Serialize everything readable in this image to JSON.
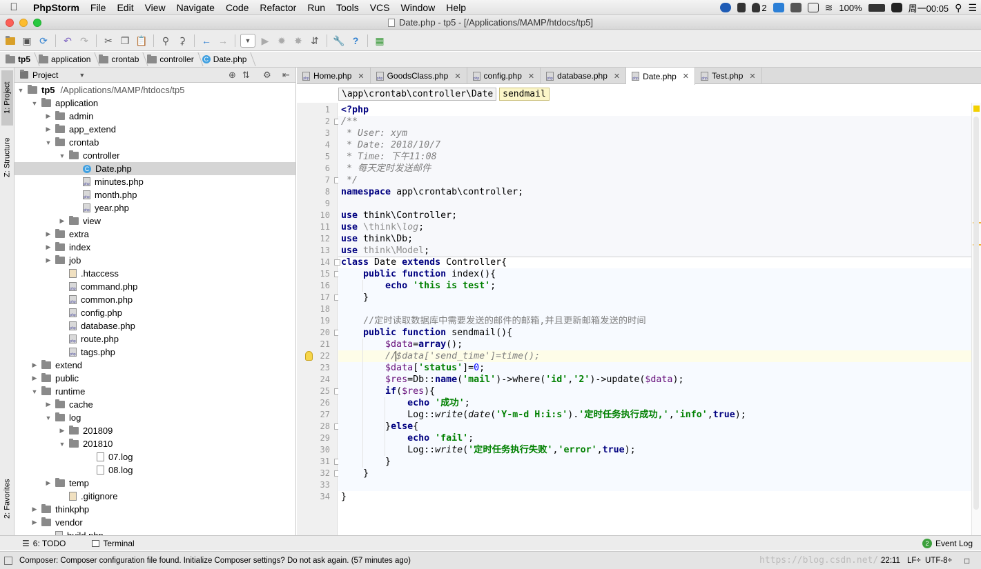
{
  "menubar": {
    "items": [
      "PhpStorm",
      "File",
      "Edit",
      "View",
      "Navigate",
      "Code",
      "Refactor",
      "Run",
      "Tools",
      "VCS",
      "Window",
      "Help"
    ],
    "right": {
      "badge": "2",
      "battery": "100%",
      "clock": "周一00:05"
    }
  },
  "window": {
    "title": "Date.php - tp5 - [/Applications/MAMP/htdocs/tp5]"
  },
  "breadcrumb": [
    "tp5",
    "application",
    "crontab",
    "controller",
    "Date.php"
  ],
  "leftstrip": {
    "project_tab": "1: Project",
    "structure_tab": "Z: Structure",
    "favorites_tab": "2: Favorites"
  },
  "project": {
    "header": "Project",
    "root_name": "tp5",
    "root_path": "/Applications/MAMP/htdocs/tp5",
    "rows": [
      {
        "label": "application",
        "depth": 1,
        "type": "folder",
        "open": true
      },
      {
        "label": "admin",
        "depth": 2,
        "type": "folder",
        "open": false
      },
      {
        "label": "app_extend",
        "depth": 2,
        "type": "folder",
        "open": false
      },
      {
        "label": "crontab",
        "depth": 2,
        "type": "folder",
        "open": true
      },
      {
        "label": "controller",
        "depth": 3,
        "type": "folder",
        "open": true
      },
      {
        "label": "Date.php",
        "depth": 4,
        "type": "class",
        "selected": true
      },
      {
        "label": "minutes.php",
        "depth": 4,
        "type": "php"
      },
      {
        "label": "month.php",
        "depth": 4,
        "type": "php"
      },
      {
        "label": "year.php",
        "depth": 4,
        "type": "php"
      },
      {
        "label": "view",
        "depth": 3,
        "type": "folder",
        "open": false
      },
      {
        "label": "extra",
        "depth": 2,
        "type": "folder",
        "open": false
      },
      {
        "label": "index",
        "depth": 2,
        "type": "folder",
        "open": false
      },
      {
        "label": "job",
        "depth": 2,
        "type": "folder",
        "open": false
      },
      {
        "label": ".htaccess",
        "depth": 3,
        "type": "file"
      },
      {
        "label": "command.php",
        "depth": 3,
        "type": "php"
      },
      {
        "label": "common.php",
        "depth": 3,
        "type": "php"
      },
      {
        "label": "config.php",
        "depth": 3,
        "type": "php"
      },
      {
        "label": "database.php",
        "depth": 3,
        "type": "php"
      },
      {
        "label": "route.php",
        "depth": 3,
        "type": "php"
      },
      {
        "label": "tags.php",
        "depth": 3,
        "type": "php"
      },
      {
        "label": "extend",
        "depth": 1,
        "type": "folder",
        "open": false
      },
      {
        "label": "public",
        "depth": 1,
        "type": "folder",
        "open": false
      },
      {
        "label": "runtime",
        "depth": 1,
        "type": "folder",
        "open": true
      },
      {
        "label": "cache",
        "depth": 2,
        "type": "folder",
        "open": false
      },
      {
        "label": "log",
        "depth": 2,
        "type": "folder",
        "open": true
      },
      {
        "label": "201809",
        "depth": 3,
        "type": "folder",
        "open": false
      },
      {
        "label": "201810",
        "depth": 3,
        "type": "folder",
        "open": true
      },
      {
        "label": "07.log",
        "depth": 5,
        "type": "log"
      },
      {
        "label": "08.log",
        "depth": 5,
        "type": "log"
      },
      {
        "label": "temp",
        "depth": 2,
        "type": "folder",
        "open": false
      },
      {
        "label": ".gitignore",
        "depth": 3,
        "type": "file"
      },
      {
        "label": "thinkphp",
        "depth": 1,
        "type": "folder",
        "open": false
      },
      {
        "label": "vendor",
        "depth": 1,
        "type": "folder",
        "open": false
      },
      {
        "label": "build.php",
        "depth": 2,
        "type": "php"
      }
    ]
  },
  "editor": {
    "tabs": [
      {
        "label": "Home.php",
        "active": false
      },
      {
        "label": "GoodsClass.php",
        "active": false
      },
      {
        "label": "config.php",
        "active": false
      },
      {
        "label": "database.php",
        "active": false
      },
      {
        "label": "Date.php",
        "active": true
      },
      {
        "label": "Test.php",
        "active": false
      }
    ],
    "nav_crumbs": [
      "\\app\\crontab\\controller\\Date",
      "sendmail"
    ],
    "current_line": 22,
    "lines": [
      [
        [
          "kw",
          "<?php"
        ]
      ],
      [
        [
          "cm",
          "/**"
        ]
      ],
      [
        [
          "cm",
          " * User: xym"
        ]
      ],
      [
        [
          "cm",
          " * Date: 2018/10/7"
        ]
      ],
      [
        [
          "cm",
          " * Time: 下午11:08"
        ]
      ],
      [
        [
          "cm",
          " * 每天定时发送邮件"
        ]
      ],
      [
        [
          "cm",
          " */"
        ]
      ],
      [
        [
          "kw",
          "namespace "
        ],
        [
          "t",
          "app\\crontab\\controller;"
        ]
      ],
      [],
      [
        [
          "kw",
          "use "
        ],
        [
          "t",
          "think\\Controller;"
        ]
      ],
      [
        [
          "kw",
          "use "
        ],
        [
          "gray",
          "\\think\\"
        ],
        [
          "fn gray",
          "log"
        ],
        [
          "t",
          ";"
        ]
      ],
      [
        [
          "kw",
          "use "
        ],
        [
          "t",
          "think\\Db;"
        ]
      ],
      [
        [
          "kw",
          "use "
        ],
        [
          "gray",
          "think\\Model"
        ],
        [
          "t",
          ";"
        ]
      ],
      [
        [
          "kw",
          "class "
        ],
        [
          "t",
          "Date "
        ],
        [
          "kw",
          "extends "
        ],
        [
          "t",
          "Controller{"
        ]
      ],
      [
        [
          "t",
          "    "
        ],
        [
          "kw",
          "public function "
        ],
        [
          "t",
          "index(){"
        ]
      ],
      [
        [
          "t",
          "        "
        ],
        [
          "kw",
          "echo "
        ],
        [
          "str",
          "'this is test'"
        ],
        [
          "t",
          ";"
        ]
      ],
      [
        [
          "t",
          "    }"
        ]
      ],
      [],
      [
        [
          "t",
          "    "
        ],
        [
          "cmz",
          "//定时读取数据库中需要发送的邮件的邮箱,并且更新邮箱发送的时间"
        ]
      ],
      [
        [
          "t",
          "    "
        ],
        [
          "kw",
          "public function "
        ],
        [
          "t",
          "sendmail(){"
        ]
      ],
      [
        [
          "t",
          "        "
        ],
        [
          "var",
          "$data"
        ],
        [
          "t",
          "="
        ],
        [
          "kw",
          "array"
        ],
        [
          "t",
          "();"
        ]
      ],
      [
        [
          "t",
          "        "
        ],
        [
          "cm",
          "//$data['send_time']=time();"
        ]
      ],
      [
        [
          "t",
          "        "
        ],
        [
          "var",
          "$data"
        ],
        [
          "t",
          "["
        ],
        [
          "str",
          "'status'"
        ],
        [
          "t",
          "]="
        ],
        [
          "num",
          "0"
        ],
        [
          "t",
          ";"
        ]
      ],
      [
        [
          "t",
          "        "
        ],
        [
          "var",
          "$res"
        ],
        [
          "t",
          "=Db::"
        ],
        [
          "kw",
          "name"
        ],
        [
          "t",
          "("
        ],
        [
          "str",
          "'mail'"
        ],
        [
          "t",
          ")->where("
        ],
        [
          "str",
          "'id'"
        ],
        [
          "t",
          ","
        ],
        [
          "str",
          "'2'"
        ],
        [
          "t",
          ")->update("
        ],
        [
          "var",
          "$data"
        ],
        [
          "t",
          ");"
        ]
      ],
      [
        [
          "t",
          "        "
        ],
        [
          "kw",
          "if"
        ],
        [
          "t",
          "("
        ],
        [
          "var",
          "$res"
        ],
        [
          "t",
          "){"
        ]
      ],
      [
        [
          "t",
          "            "
        ],
        [
          "kw",
          "echo "
        ],
        [
          "str",
          "'成功'"
        ],
        [
          "t",
          ";"
        ]
      ],
      [
        [
          "t",
          "            Log::"
        ],
        [
          "fn",
          "write"
        ],
        [
          "t",
          "("
        ],
        [
          "fn",
          "date"
        ],
        [
          "t",
          "("
        ],
        [
          "str",
          "'Y-m-d H:i:s'"
        ],
        [
          "t",
          ")."
        ],
        [
          "str",
          "'定时任务执行成功,'"
        ],
        [
          "t",
          ","
        ],
        [
          "str",
          "'info'"
        ],
        [
          "t",
          ","
        ],
        [
          "kw",
          "true"
        ],
        [
          "t",
          ");"
        ]
      ],
      [
        [
          "t",
          "        }"
        ],
        [
          "kw",
          "else"
        ],
        [
          "t",
          "{"
        ]
      ],
      [
        [
          "t",
          "            "
        ],
        [
          "kw",
          "echo "
        ],
        [
          "str",
          "'fail'"
        ],
        [
          "t",
          ";"
        ]
      ],
      [
        [
          "t",
          "            Log::"
        ],
        [
          "fn",
          "write"
        ],
        [
          "t",
          "("
        ],
        [
          "str",
          "'定时任务执行失败'"
        ],
        [
          "t",
          ","
        ],
        [
          "str",
          "'error'"
        ],
        [
          "t",
          ","
        ],
        [
          "kw",
          "true"
        ],
        [
          "t",
          ");"
        ]
      ],
      [
        [
          "t",
          "        }"
        ]
      ],
      [
        [
          "t",
          "    }"
        ]
      ],
      [],
      [
        [
          "t",
          "}"
        ]
      ]
    ]
  },
  "bottombar": {
    "todo": "6: TODO",
    "terminal": "Terminal",
    "event_count": "2",
    "event_log": "Event Log"
  },
  "statusbar": {
    "message": "Composer: Composer configuration file found. Initialize Composer settings? Do not ask again. (57 minutes ago)",
    "position": "22:11",
    "line_sep": "LF÷",
    "encoding": "UTF-8÷",
    "watermark": "https://blog.csdn.net/..."
  },
  "colors": {
    "accent": "#40a0e0",
    "current_line": "#fefde8",
    "selection": "#d5d5d5",
    "keyword": "#000080",
    "string": "#008000"
  }
}
